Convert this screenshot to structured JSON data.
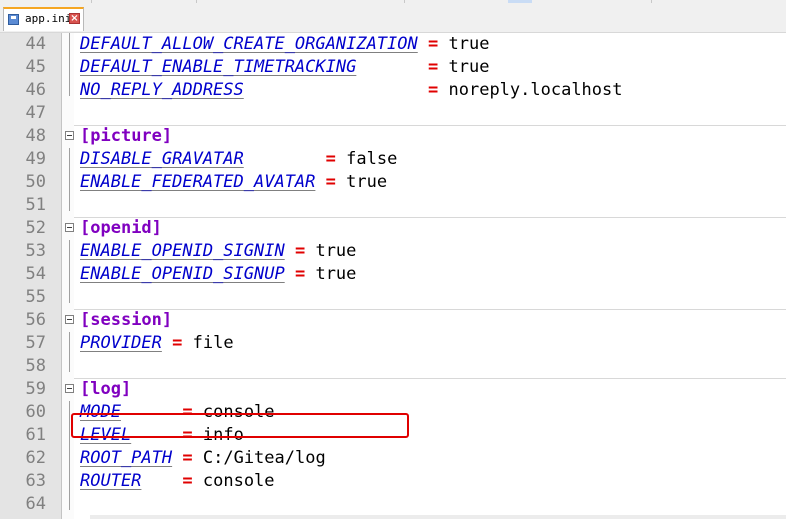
{
  "tab": {
    "filename": "app.ini",
    "icon": "save-icon",
    "close_icon": "close-icon"
  },
  "colors": {
    "key": "#0000cc",
    "equals": "#e00000",
    "section": "#8000c0",
    "line_number": "#808080",
    "highlight": "#e00000"
  },
  "lines": [
    {
      "no": "44",
      "type": "kv",
      "key": "DEFAULT_ALLOW_CREATE_ORGANIZATION",
      "pad": " ",
      "value": "true"
    },
    {
      "no": "45",
      "type": "kv",
      "key": "DEFAULT_ENABLE_TIMETRACKING",
      "pad": "       ",
      "value": "true"
    },
    {
      "no": "46",
      "type": "kv",
      "key": "NO_REPLY_ADDRESS",
      "pad": "                  ",
      "value": "noreply.localhost"
    },
    {
      "no": "47",
      "type": "blank"
    },
    {
      "no": "48",
      "type": "section",
      "name": "picture"
    },
    {
      "no": "49",
      "type": "kv",
      "key": "DISABLE_GRAVATAR",
      "pad": "        ",
      "value": "false"
    },
    {
      "no": "50",
      "type": "kv",
      "key": "ENABLE_FEDERATED_AVATAR",
      "pad": " ",
      "value": "true"
    },
    {
      "no": "51",
      "type": "blank"
    },
    {
      "no": "52",
      "type": "section",
      "name": "openid"
    },
    {
      "no": "53",
      "type": "kv",
      "key": "ENABLE_OPENID_SIGNIN",
      "pad": " ",
      "value": "true"
    },
    {
      "no": "54",
      "type": "kv",
      "key": "ENABLE_OPENID_SIGNUP",
      "pad": " ",
      "value": "true"
    },
    {
      "no": "55",
      "type": "blank"
    },
    {
      "no": "56",
      "type": "section",
      "name": "session"
    },
    {
      "no": "57",
      "type": "kv",
      "key": "PROVIDER",
      "pad": " ",
      "value": "file"
    },
    {
      "no": "58",
      "type": "blank"
    },
    {
      "no": "59",
      "type": "section",
      "name": "log"
    },
    {
      "no": "60",
      "type": "kv",
      "key": "MODE",
      "pad": "      ",
      "value": "console"
    },
    {
      "no": "61",
      "type": "kv",
      "key": "LEVEL",
      "pad": "     ",
      "value": "info"
    },
    {
      "no": "62",
      "type": "kv",
      "key": "ROOT_PATH",
      "pad": " ",
      "value": "C:/Gitea/log",
      "highlighted": true
    },
    {
      "no": "63",
      "type": "kv",
      "key": "ROUTER",
      "pad": "    ",
      "value": "console"
    },
    {
      "no": "64",
      "type": "blank"
    }
  ]
}
